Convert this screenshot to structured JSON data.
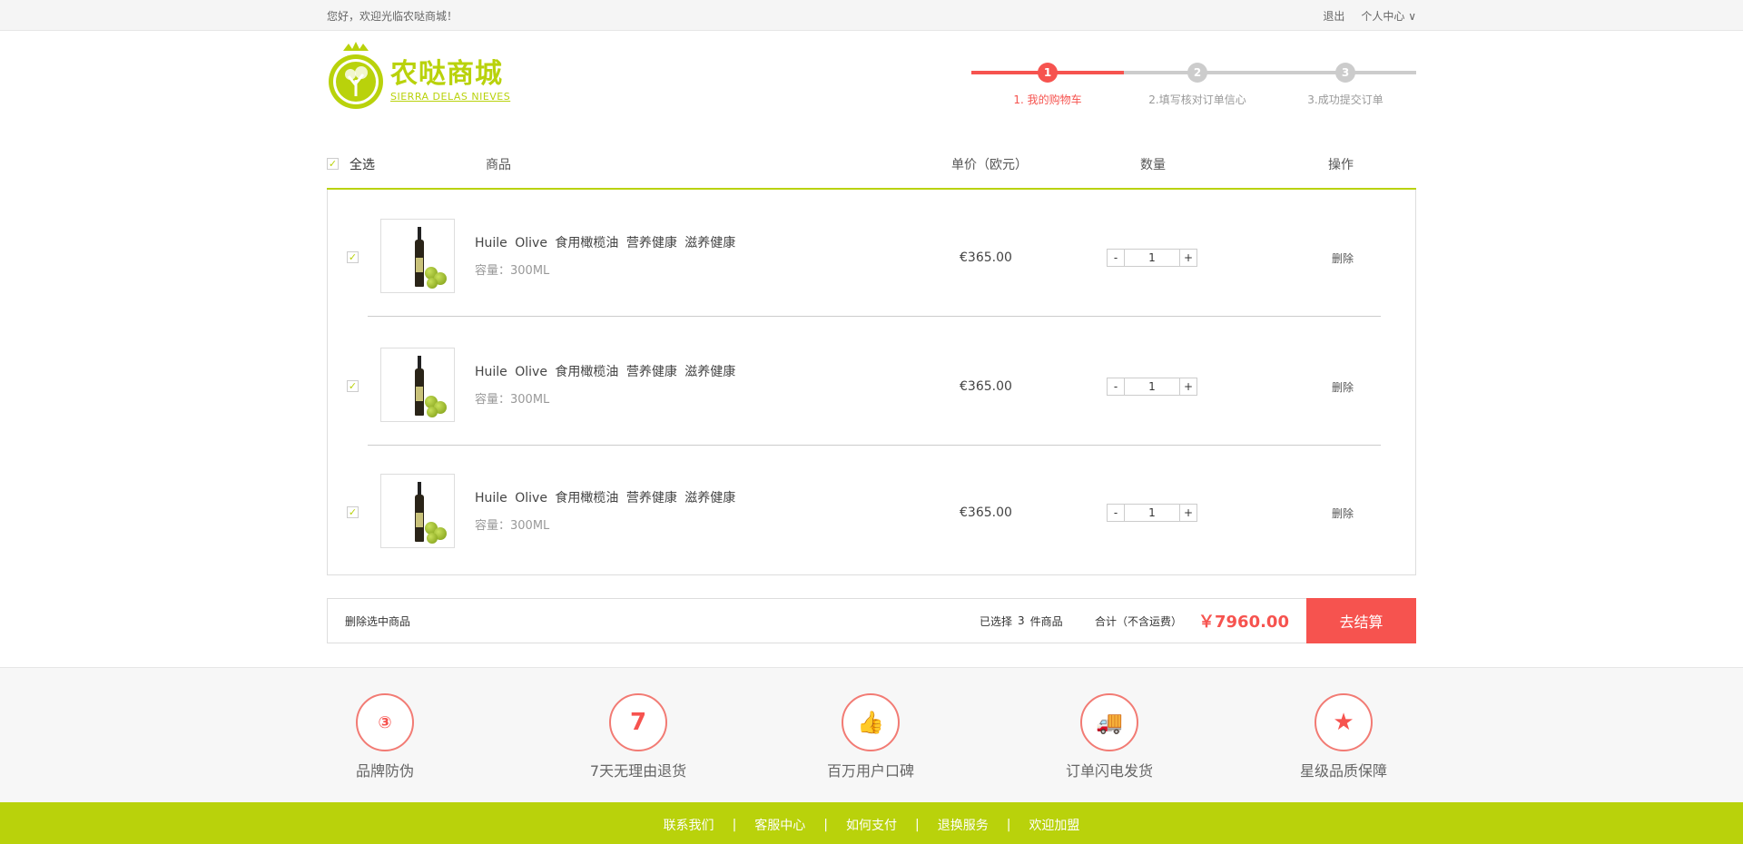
{
  "topbar": {
    "welcome": "您好，欢迎光临农哒商城！",
    "logout": "退出",
    "personal_center": "个人中心 ∨"
  },
  "logo": {
    "name": "农哒商城",
    "subtitle": "SIERRA DELAS NIEVES"
  },
  "steps": [
    {
      "num": "1",
      "label": "1. 我的购物车",
      "active": true
    },
    {
      "num": "2",
      "label": "2.填写核对订单信心",
      "active": false
    },
    {
      "num": "3",
      "label": "3.成功提交订单",
      "active": false
    }
  ],
  "cart_header": {
    "select_all": "全选",
    "product": "商品",
    "unit_price": "单价（欧元）",
    "quantity": "数量",
    "action": "操作"
  },
  "items": [
    {
      "checked": true,
      "name": "Huile Olive 食用橄榄油 营养健康 滋养健康",
      "spec": "容量：300ML",
      "price": "€365.00",
      "qty": "1",
      "delete": "删除"
    },
    {
      "checked": true,
      "name": "Huile Olive 食用橄榄油 营养健康 滋养健康",
      "spec": "容量：300ML",
      "price": "€365.00",
      "qty": "1",
      "delete": "删除"
    },
    {
      "checked": true,
      "name": "Huile Olive 食用橄榄油 营养健康 滋养健康",
      "spec": "容量：300ML",
      "price": "€365.00",
      "qty": "1",
      "delete": "删除"
    }
  ],
  "qty_controls": {
    "minus": "-",
    "plus": "+"
  },
  "summary": {
    "delete_selected": "删除选中商品",
    "selected_prefix": "已选择",
    "selected_count": "3",
    "selected_suffix": "件商品",
    "total_label": "合计（不含运费）",
    "total": "￥7960.00",
    "checkout": "去结算"
  },
  "features": [
    {
      "icon": "anti-fake-icon",
      "glyph": "③",
      "label": "品牌防伪"
    },
    {
      "icon": "return-7days-icon",
      "glyph": "7",
      "label": "7天无理由退货"
    },
    {
      "icon": "thumbs-up-icon",
      "glyph": "👍",
      "label": "百万用户口碑"
    },
    {
      "icon": "truck-icon",
      "glyph": "🚚",
      "label": "订单闪电发货"
    },
    {
      "icon": "star-icon",
      "glyph": "★",
      "label": "星级品质保障"
    }
  ],
  "footer": {
    "links": [
      "联系我们",
      "客服中心",
      "如何支付",
      "退换服务",
      "欢迎加盟"
    ],
    "separator": "|"
  },
  "colors": {
    "accent_green": "#b9d20b",
    "accent_red": "#f6534f"
  }
}
